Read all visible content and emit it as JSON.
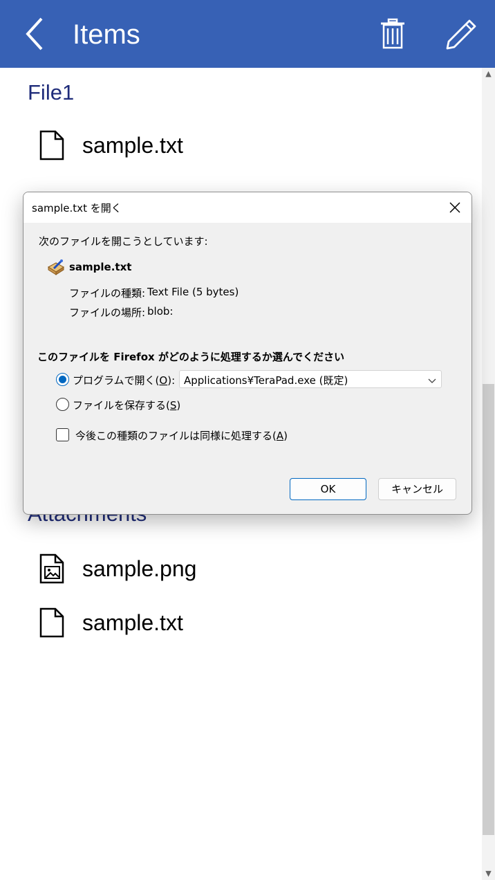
{
  "header": {
    "title": "Items",
    "back_icon": "back-chevron-icon",
    "delete_icon": "trash-icon",
    "edit_icon": "pencil-icon",
    "background": "#3761b5"
  },
  "sections": {
    "file1": {
      "title": "File1",
      "files": [
        {
          "name": "sample.txt",
          "icon": "text-file-icon"
        }
      ]
    },
    "attachments": {
      "title": "Attachments",
      "files": [
        {
          "name": "sample.png",
          "icon": "image-file-icon"
        },
        {
          "name": "sample.txt",
          "icon": "text-file-icon"
        }
      ]
    }
  },
  "dialog": {
    "title": "sample.txt を開く",
    "intro": "次のファイルを開こうとしています:",
    "file_name": "sample.txt",
    "file_type_label": "ファイルの種類:",
    "file_type_value": "Text File (5 bytes)",
    "file_location_label": "ファイルの場所:",
    "file_location_value": "blob:",
    "question": "このファイルを Firefox がどのように処理するか選んでください",
    "open_with_label": "プログラムで開く(",
    "open_with_key": "O",
    "open_with_suffix": "):",
    "open_with_app": "Applications¥TeraPad.exe (既定)",
    "save_label": "ファイルを保存する(",
    "save_key": "S",
    "save_suffix": ")",
    "remember_label": "今後この種類のファイルは同様に処理する(",
    "remember_key": "A",
    "remember_suffix": ")",
    "ok_button": "OK",
    "cancel_button": "キャンセル",
    "selected_option": "open_with",
    "remember_checked": false,
    "accent": "#0067c0"
  }
}
